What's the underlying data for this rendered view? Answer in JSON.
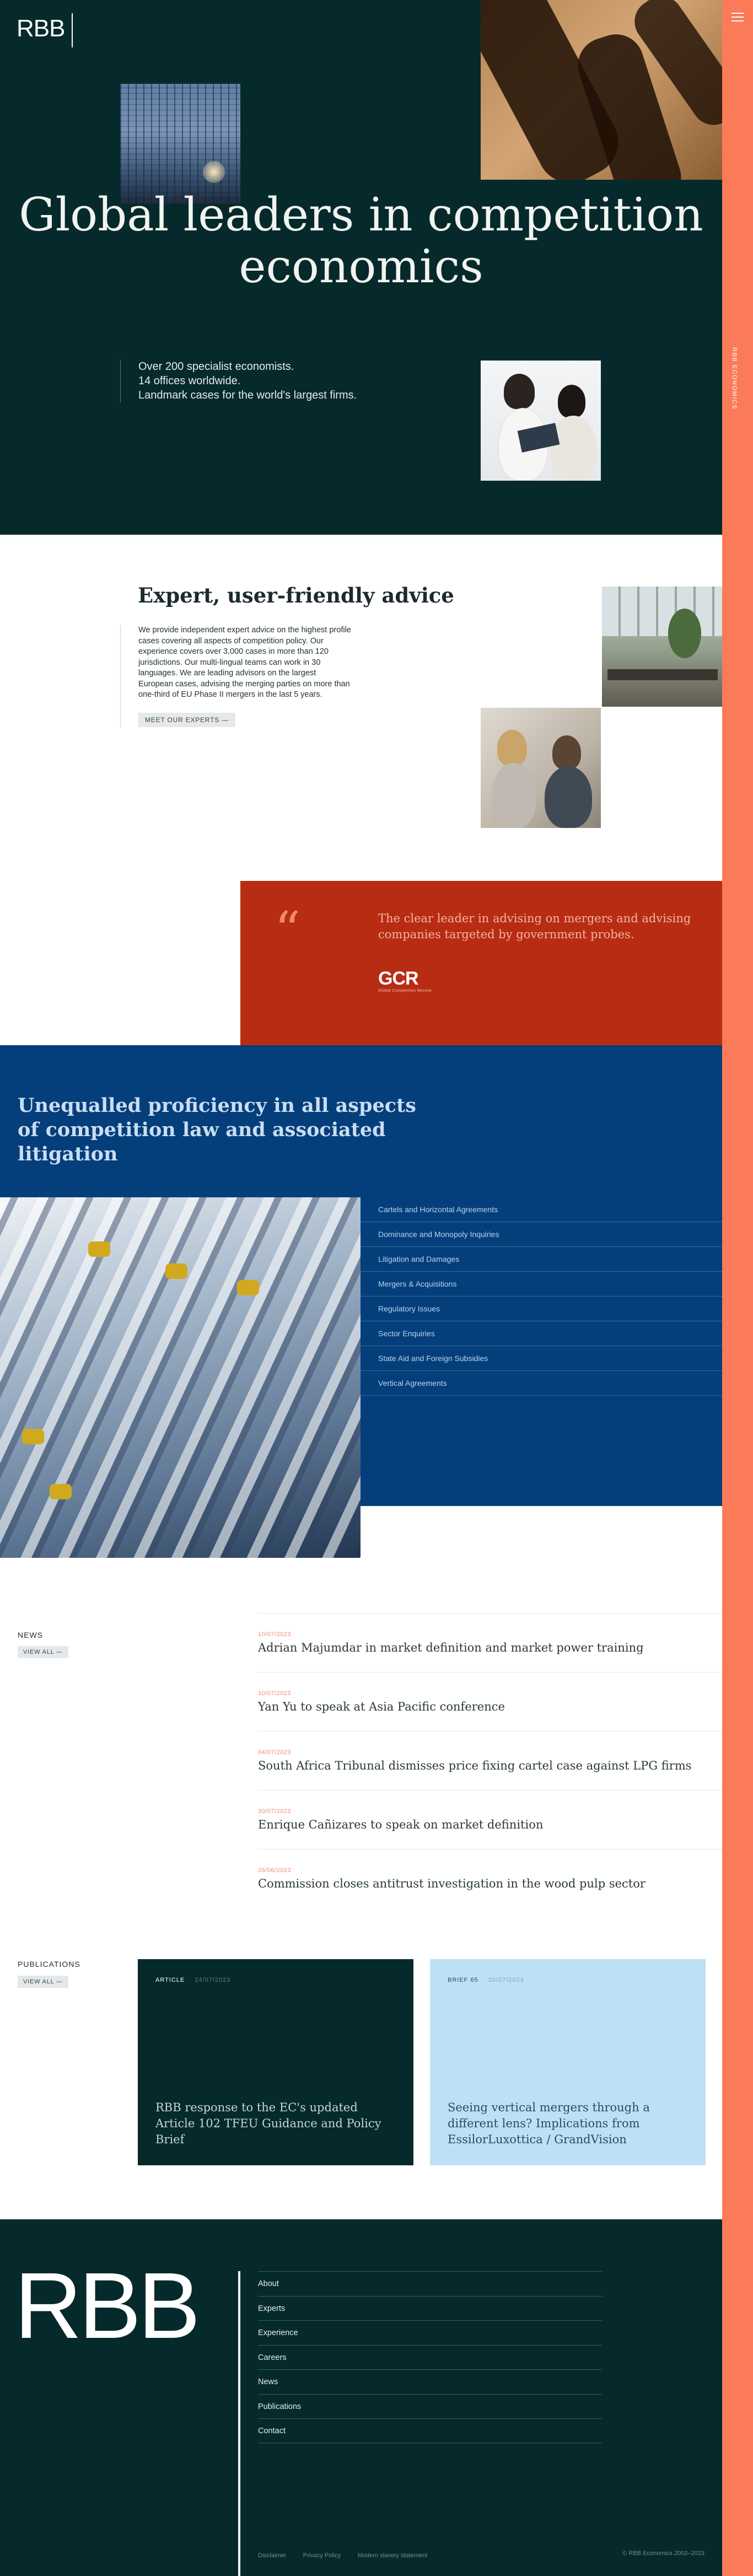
{
  "brand": {
    "logo": "RBB",
    "rail_label": "RBB ECONOMICS"
  },
  "hero": {
    "title": "Global leaders in competition economics",
    "stats": [
      "Over 200 specialist economists.",
      "14 offices worldwide.",
      "Landmark cases for the world's largest firms."
    ]
  },
  "advice": {
    "title": "Expert, user-friendly advice",
    "text": "We provide independent expert advice on the highest profile cases covering all aspects of competition policy. Our experience covers over 3,000 cases in more than 120 jurisdictions. Our multi-lingual teams can work in 30 languages. We are leading advisors on the largest European cases, advising the merging parties on more than one-third of EU Phase II mergers in the last 5 years.",
    "button": "MEET OUR EXPERTS"
  },
  "quote": {
    "mark": "“",
    "text": "The clear leader in advising on mergers and advising companies targeted by government probes.",
    "source_logo": "GCR",
    "source_sub": "Global Competition Review"
  },
  "expertise": {
    "heading": "Unequalled proficiency in all aspects of competition law and associated litigation",
    "services": [
      "Cartels and Horizontal Agreements",
      "Dominance and Monopoly Inquiries",
      "Litigation and Damages",
      "Mergers & Acquisitions",
      "Regulatory Issues",
      "Sector Enquiries",
      "State Aid and Foreign Subsidies",
      "Vertical Agreements"
    ]
  },
  "news": {
    "label": "NEWS",
    "view_all": "VIEW ALL",
    "items": [
      {
        "date": "10/07/2023",
        "title": "Adrian Majumdar in market definition and market power training"
      },
      {
        "date": "10/07/2023",
        "title": "Yan Yu to speak at Asia Pacific conference"
      },
      {
        "date": "04/07/2023",
        "title": "South Africa Tribunal dismisses price fixing cartel case against LPG firms"
      },
      {
        "date": "30/07/2023",
        "title": "Enrique Cañizares to speak on market definition"
      },
      {
        "date": "26/06/2023",
        "title": "Commission closes antitrust investigation in the wood pulp sector"
      }
    ]
  },
  "publications": {
    "label": "PUBLICATIONS",
    "view_all": "VIEW ALL",
    "cards": [
      {
        "tag": "ARTICLE",
        "date": "24/07/2023",
        "title": "RBB response to the EC's updated Article 102 TFEU Guidance and Policy Brief"
      },
      {
        "tag": "BRIEF 65",
        "date": "20/07/2023",
        "title": "Seeing vertical mergers through a different lens? Implications from EssilorLuxottica / GrandVision"
      }
    ]
  },
  "footer": {
    "logo": "RBB",
    "nav": [
      "About",
      "Experts",
      "Experience",
      "Careers",
      "News",
      "Publications",
      "Contact"
    ],
    "links": [
      "Disclaimer",
      "Privacy Policy",
      "Modern slavery statement"
    ],
    "copyright": "© RBB Economics 2002–2023"
  },
  "colors": {
    "dark_teal": "#062a2c",
    "accent_orange": "#fb7b59",
    "quote_red": "#b82c14",
    "navy_blue": "#053f7b",
    "light_blue": "#bde0f7"
  },
  "icons": {
    "menu": "hamburger-menu-icon",
    "arrow": "arrow-right-icon"
  }
}
